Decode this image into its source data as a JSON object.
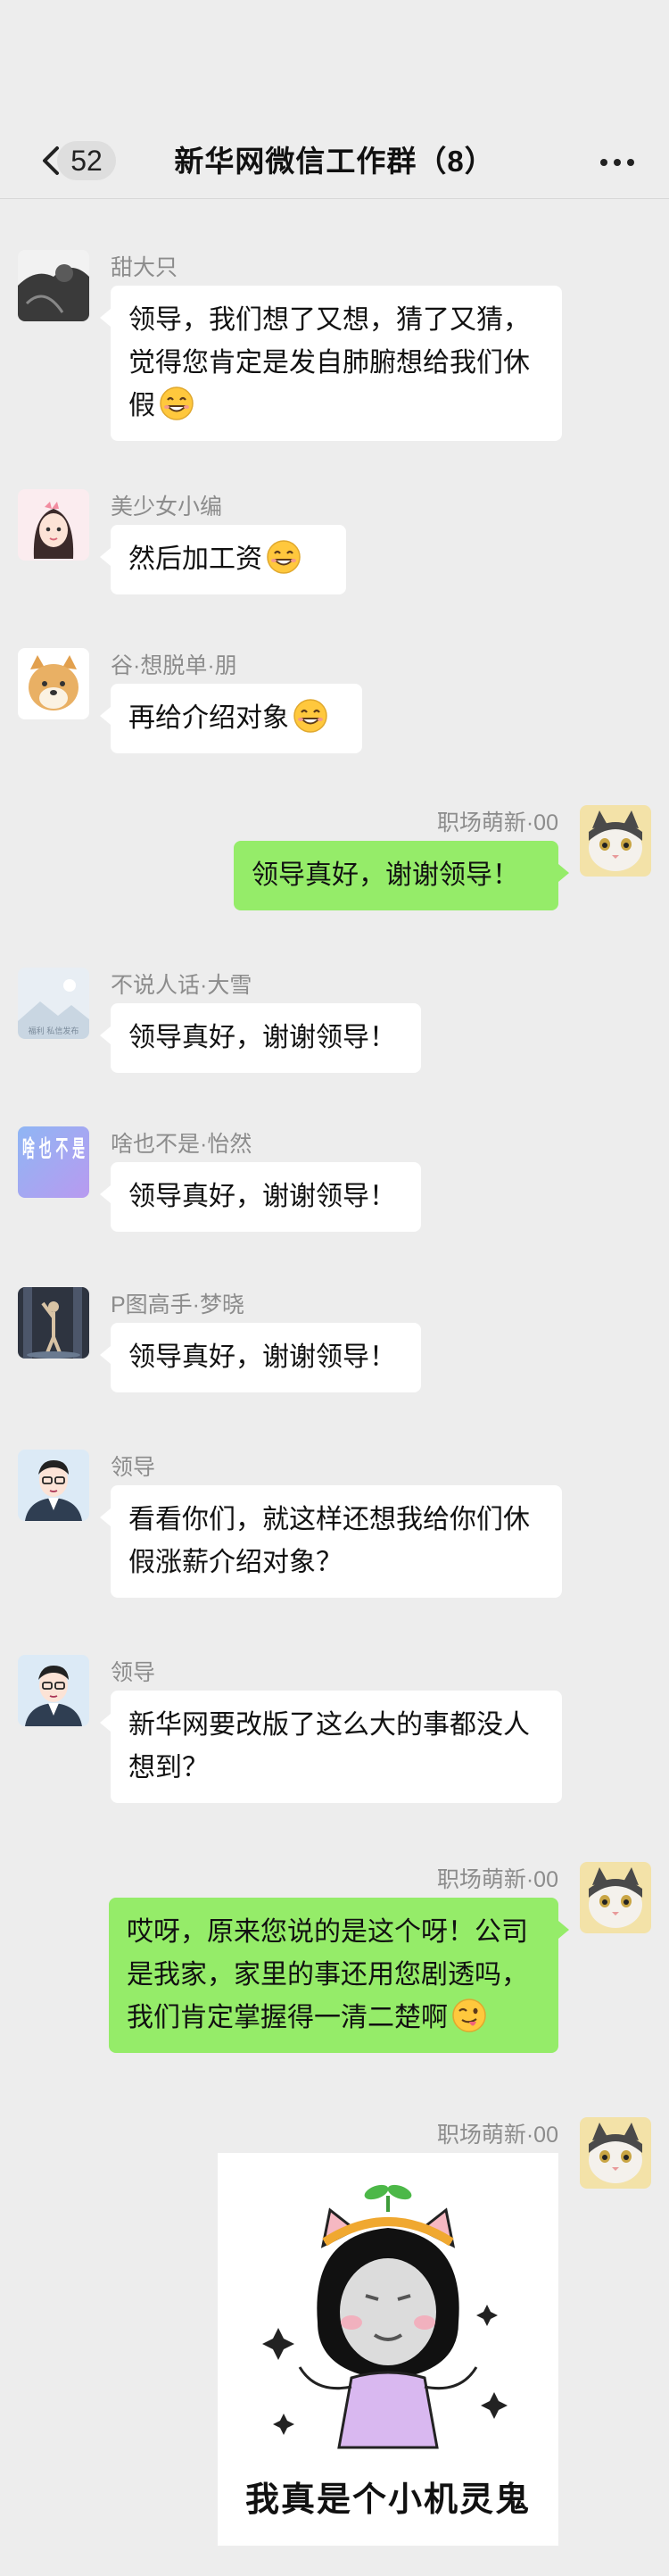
{
  "header": {
    "unread_count": "52",
    "title": "新华网微信工作群（8）"
  },
  "messages": [
    {
      "sender": "甜大只",
      "text": "领导，我们想了又想，猜了又猜，觉得您肯定是发自肺腑想给我们休假",
      "emoji": "grinning-face-emoji"
    },
    {
      "sender": "美少女小编",
      "text": "然后加工资",
      "emoji": "grinning-face-emoji"
    },
    {
      "sender": "谷·想脱单·朋",
      "text": "再给介绍对象",
      "emoji": "grinning-face-emoji"
    },
    {
      "sender": "职场萌新·00",
      "text": "领导真好，谢谢领导！"
    },
    {
      "sender": "不说人话·大雪",
      "text": "领导真好，谢谢领导！",
      "avatar_caption": "福利 私信发布"
    },
    {
      "sender": "啥也不是·怡然",
      "text": "领导真好，谢谢领导！",
      "avatar_text": "啥 也 不 是"
    },
    {
      "sender": "P图高手·梦晓",
      "text": "领导真好，谢谢领导！"
    },
    {
      "sender": "领导",
      "text": "看看你们，就这样还想我给你们休假涨薪介绍对象？"
    },
    {
      "sender": "领导",
      "text": "新华网要改版了这么大的事都没人想到？"
    },
    {
      "sender": "职场萌新·00",
      "text": "哎呀，原来您说的是这个呀！公司是我家，家里的事还用您剧透吗，我们肯定掌握得一清二楚啊",
      "emoji": "winking-tongue-emoji"
    },
    {
      "sender": "职场萌新·00",
      "sticker_caption": "我真是个小机灵鬼"
    }
  ]
}
